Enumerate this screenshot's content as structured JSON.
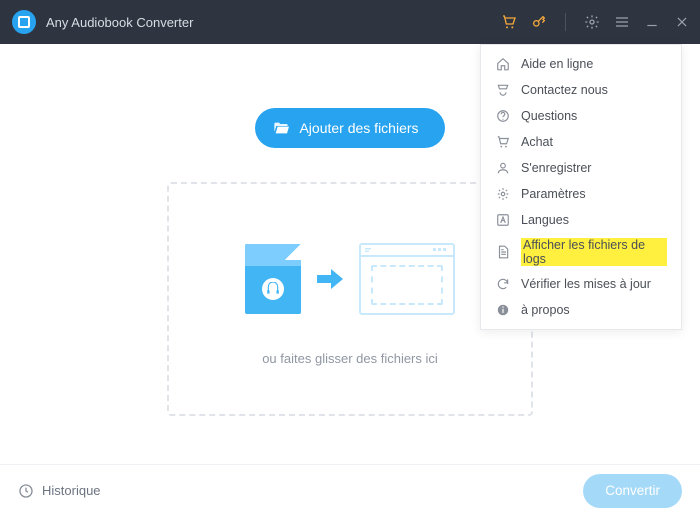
{
  "app": {
    "title": "Any Audiobook Converter"
  },
  "main": {
    "add_button": "Ajouter des fichiers",
    "drop_hint": "ou faites glisser des fichiers ici"
  },
  "menu": {
    "items": [
      {
        "icon": "help-icon",
        "label": "Aide en ligne"
      },
      {
        "icon": "phone-icon",
        "label": "Contactez nous"
      },
      {
        "icon": "question-icon",
        "label": "Questions"
      },
      {
        "icon": "cart-icon",
        "label": "Achat"
      },
      {
        "icon": "user-icon",
        "label": "S'enregistrer"
      },
      {
        "icon": "gear-icon",
        "label": "Paramètres"
      },
      {
        "icon": "language-icon",
        "label": "Langues"
      },
      {
        "icon": "file-icon",
        "label": "Afficher les fichiers de logs",
        "highlight": true
      },
      {
        "icon": "refresh-icon",
        "label": "Vérifier les mises à jour"
      },
      {
        "icon": "info-icon",
        "label": "à propos"
      }
    ]
  },
  "footer": {
    "history": "Historique",
    "convert": "Convertir"
  },
  "colors": {
    "accent": "#28a3ef",
    "titlebar": "#2e3440",
    "highlight_tb": "#f4a93c"
  }
}
